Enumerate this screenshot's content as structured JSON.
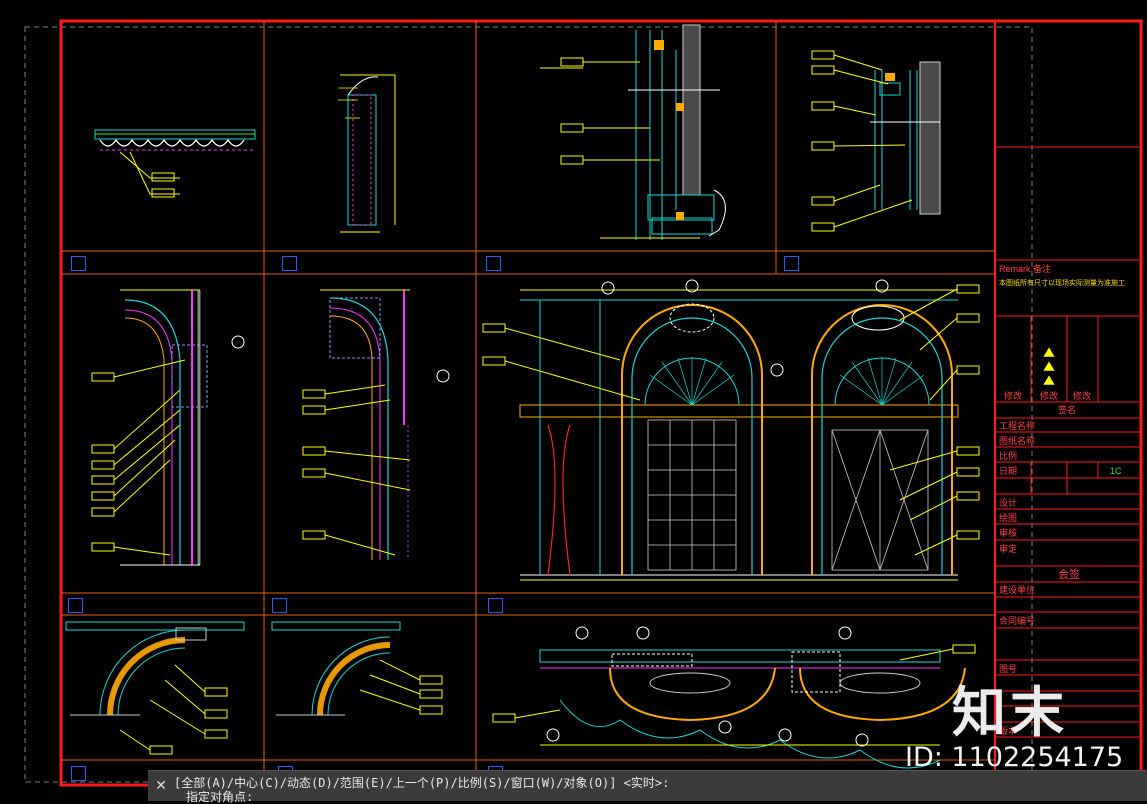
{
  "colors": {
    "background": "#000000",
    "frame": "#ff1a1a",
    "grid": "#e85a1a",
    "cyan": "#18d6d6",
    "yellow": "#ffff00",
    "green": "#2ee82e",
    "magenta": "#ff30ff",
    "blue": "#2d5bff",
    "white": "#ffffff"
  },
  "title_block": {
    "remark_label": "Remark 备注",
    "remark_text": "本图纸所有尺寸以现场实际测量为准施工",
    "revision_tags": [
      "修改",
      "修改",
      "修改"
    ],
    "sign_label": "签名",
    "rows": [
      "工程名称",
      "图纸名称",
      "比例",
      "日期",
      "设计",
      "绘图",
      "审核",
      "审定"
    ],
    "scale_value": "1C",
    "countersign": "会签",
    "lower_rows": [
      "建设单位",
      "合同编号"
    ],
    "bottom_rows": [
      "图号",
      "版本"
    ]
  },
  "command_line": {
    "prompt": "[全部(A)/中心(C)/动态(D)/范围(E)/上一个(P)/比例(S)/窗口(W)/对象(O)] <实时>:",
    "input": "指定对角点:"
  },
  "watermark": {
    "logo": "知末",
    "id": "ID: 1102254175"
  },
  "viewports": [
    {
      "id": "vp-1"
    },
    {
      "id": "vp-2"
    },
    {
      "id": "vp-3"
    },
    {
      "id": "vp-4"
    },
    {
      "id": "vp-5"
    },
    {
      "id": "vp-6"
    },
    {
      "id": "vp-7"
    },
    {
      "id": "vp-8"
    },
    {
      "id": "vp-9"
    },
    {
      "id": "vp-10"
    }
  ]
}
